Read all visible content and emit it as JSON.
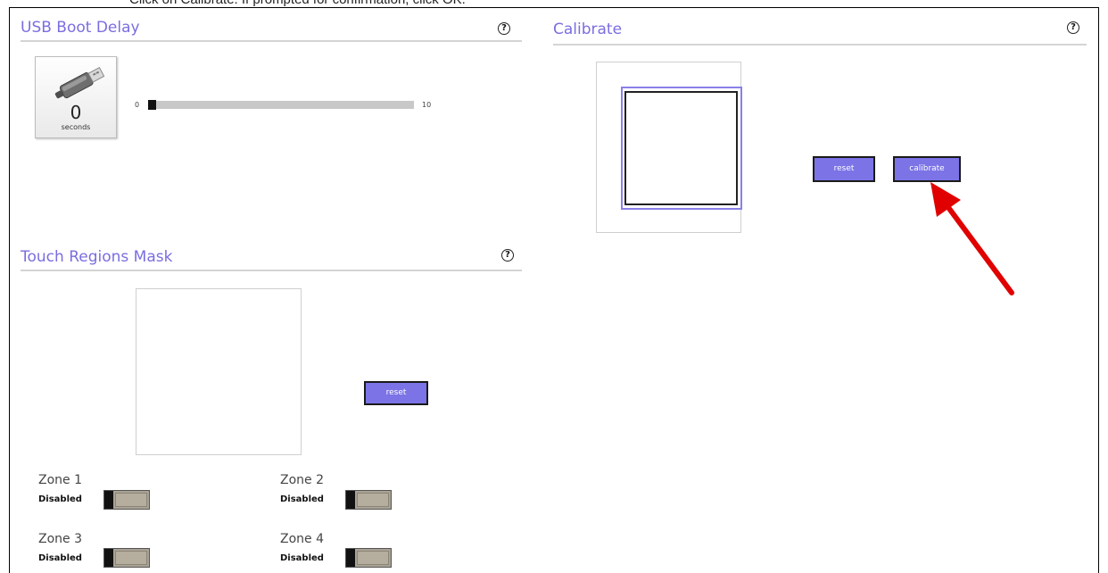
{
  "caption": {
    "text": "Click on Calibrate. If prompted for confirmation, click OK."
  },
  "usb_boot_delay": {
    "title": "USB Boot Delay",
    "help_glyph": "?",
    "value": "0",
    "unit": "seconds",
    "slider": {
      "min_label": "0",
      "max_label": "10",
      "min": 0,
      "max": 10,
      "value": 0
    }
  },
  "touch_regions_mask": {
    "title": "Touch Regions Mask",
    "help_glyph": "?",
    "reset_label": "reset",
    "zones": [
      {
        "name": "Zone 1",
        "status": "Disabled"
      },
      {
        "name": "Zone 2",
        "status": "Disabled"
      },
      {
        "name": "Zone 3",
        "status": "Disabled"
      },
      {
        "name": "Zone 4",
        "status": "Disabled"
      }
    ]
  },
  "calibrate": {
    "title": "Calibrate",
    "help_glyph": "?",
    "reset_label": "reset",
    "calibrate_label": "calibrate"
  },
  "colors": {
    "accent": "#7b73e6",
    "title": "#7a6ee0",
    "arrow": "#e00000"
  },
  "icons": [
    "usb-drive-icon",
    "help-icon",
    "arrow-pointer-icon"
  ]
}
